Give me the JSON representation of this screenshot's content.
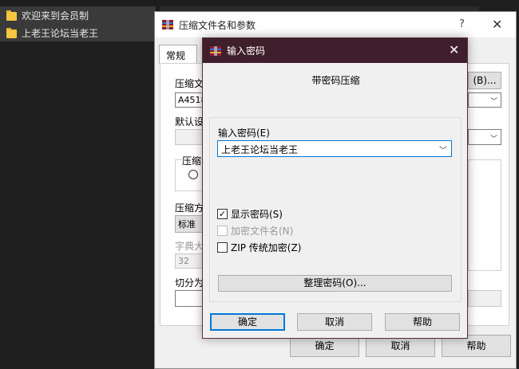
{
  "file_list": {
    "items": [
      {
        "label": "欢迎来到会员制"
      },
      {
        "label": "上老王论坛当老王"
      }
    ]
  },
  "back_dialog": {
    "title": "压缩文件名和参数",
    "help_symbol": "?",
    "close_symbol": "✕",
    "tab_general": "常规",
    "archive_name_label": "压缩文",
    "archive_name_value": "A4518",
    "browse_button": "(B)...",
    "default_profile_label": "默认设",
    "compress_format_label": "压缩",
    "compress_method_label": "压缩方",
    "compress_method_value": "标准",
    "dict_size_label": "字典大",
    "dict_size_value": "32",
    "split_label": "切分为",
    "ok_button": "确定",
    "cancel_button": "取消",
    "help_button": "帮助"
  },
  "password_dialog": {
    "title": "输入密码",
    "close_symbol": "✕",
    "subtitle": "带密码压缩",
    "password_label": "输入密码(E)",
    "password_value": "上老王论坛当老王",
    "show_password_label": "显示密码(S)",
    "show_password_checked": true,
    "encrypt_names_label": "加密文件名(N)",
    "encrypt_names_enabled": false,
    "zip_legacy_label": "ZIP 传统加密(Z)",
    "zip_legacy_checked": false,
    "manage_button": "整理密码(O)...",
    "ok_button": "确定",
    "cancel_button": "取消",
    "help_button": "帮助"
  },
  "colors": {
    "front_titlebar": "#3f1f2b",
    "accent_border": "#0078d7",
    "folder": "#f5c542"
  }
}
